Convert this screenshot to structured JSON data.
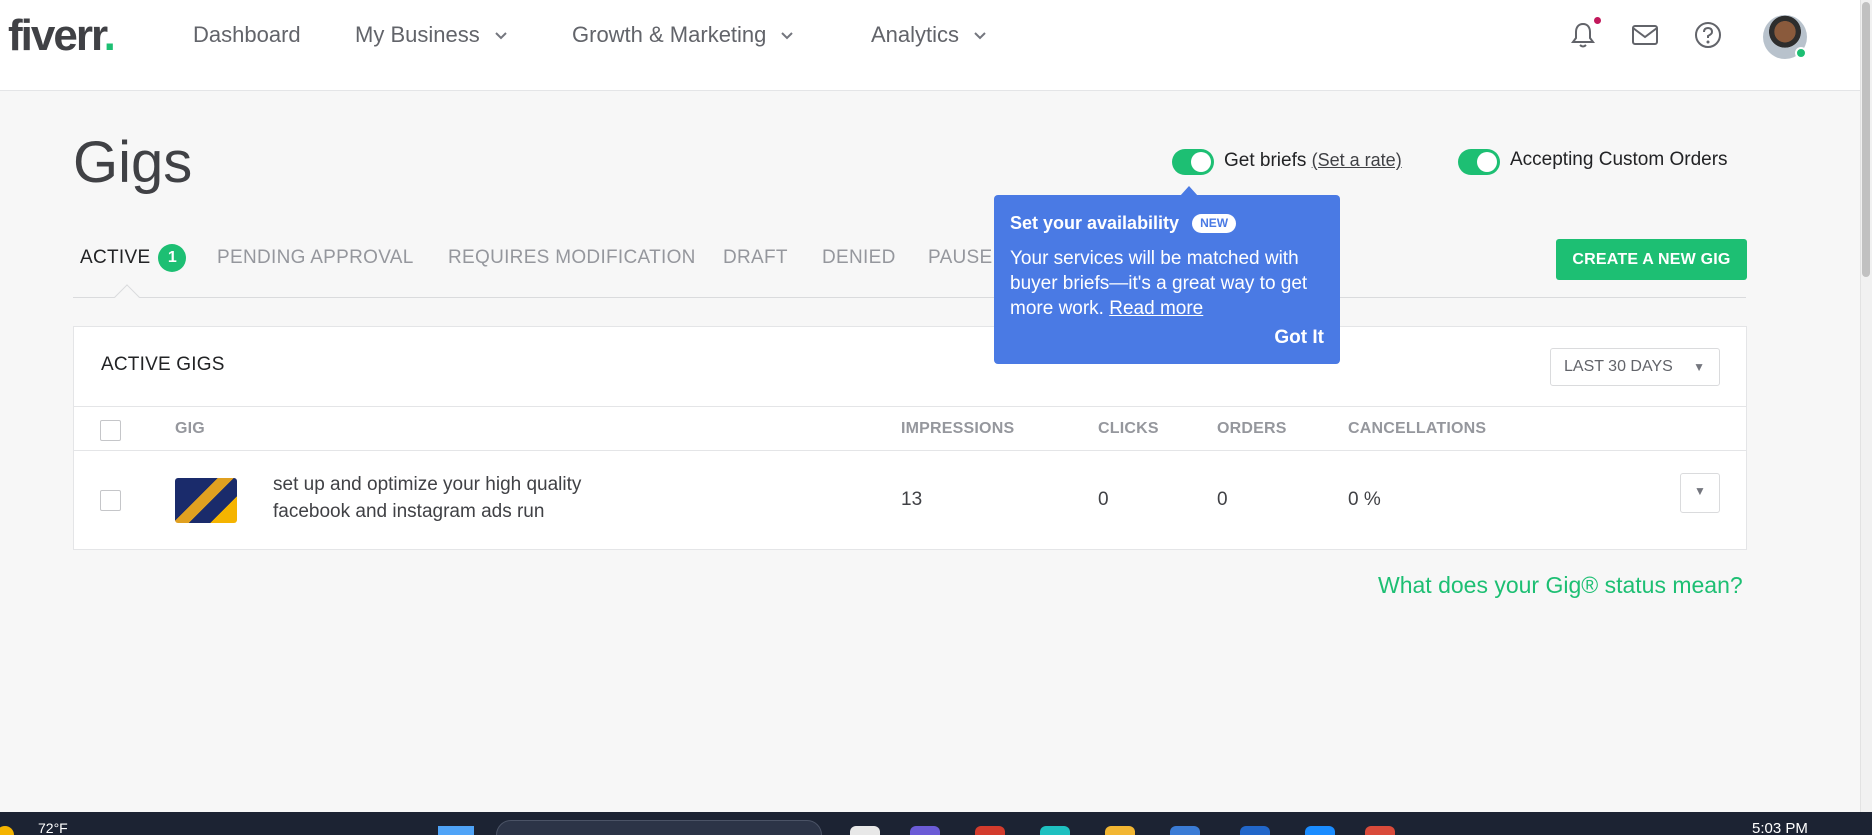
{
  "brand": {
    "logo_text": "fiverr",
    "logo_dot": ".",
    "accent": "#1dbf73",
    "popover_color": "#4a7ae4"
  },
  "nav": {
    "items": [
      {
        "label": "Dashboard"
      },
      {
        "label": "My Business"
      },
      {
        "label": "Growth & Marketing"
      },
      {
        "label": "Analytics"
      }
    ],
    "icons": [
      "bell-icon",
      "envelope-icon",
      "question-icon",
      "avatar"
    ]
  },
  "page": {
    "title": "Gigs"
  },
  "toggles": {
    "briefs": {
      "label": "Get briefs",
      "link": "(Set a rate)",
      "on": true
    },
    "custom_orders": {
      "label": "Accepting Custom Orders",
      "on": true
    }
  },
  "tabs": [
    {
      "label": "ACTIVE",
      "badge": "1",
      "active": true
    },
    {
      "label": "PENDING APPROVAL"
    },
    {
      "label": "REQUIRES MODIFICATION"
    },
    {
      "label": "DRAFT"
    },
    {
      "label": "DENIED"
    },
    {
      "label": "PAUSED"
    }
  ],
  "create_button": "CREATE A NEW GIG",
  "popover": {
    "title": "Set your availability",
    "badge": "NEW",
    "body": "Your services will be matched with buyer briefs—it's a great way to get more work.",
    "read_more": "Read more",
    "got_it": "Got It"
  },
  "table": {
    "title": "ACTIVE GIGS",
    "range": "LAST 30 DAYS",
    "columns": [
      "GIG",
      "IMPRESSIONS",
      "CLICKS",
      "ORDERS",
      "CANCELLATIONS"
    ],
    "rows": [
      {
        "title": "set up and optimize your high quality facebook and instagram ads run",
        "impressions": "13",
        "clicks": "0",
        "orders": "0",
        "cancellations": "0 %"
      }
    ]
  },
  "status_link": "What does your Gig® status mean?",
  "taskbar": {
    "weather": "72°F",
    "time": "5:03 PM"
  }
}
